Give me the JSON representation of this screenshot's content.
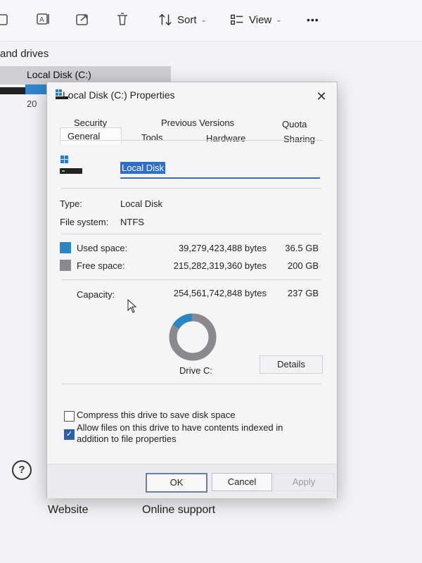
{
  "toolbar": {
    "sort_label": "Sort",
    "view_label": "View",
    "more_label": "•••"
  },
  "explorer": {
    "section_label": "and drives",
    "drive_item": "Local Disk (C:)",
    "drive_size_fragment": "20",
    "footer_links": [
      "Website",
      "Online support"
    ],
    "help_icon_text": "?"
  },
  "dialog": {
    "title": "Local Disk (C:) Properties",
    "close_icon": "✕",
    "tabs_row1": [
      "Security",
      "Previous Versions",
      "Quota"
    ],
    "tabs_row2": [
      "General",
      "Tools",
      "Hardware",
      "Sharing"
    ],
    "active_tab": "General",
    "drive_name": "Local Disk",
    "type_label": "Type:",
    "type_value": "Local Disk",
    "fs_label": "File system:",
    "fs_value": "NTFS",
    "used": {
      "label": "Used space:",
      "bytes": "39,279,423,488 bytes",
      "gb": "36.5 GB",
      "color": "#2b86c6"
    },
    "free": {
      "label": "Free space:",
      "bytes": "215,282,319,360 bytes",
      "gb": "200 GB",
      "color": "#8a8a8e"
    },
    "capacity": {
      "label": "Capacity:",
      "bytes": "254,561,742,848 bytes",
      "gb": "237 GB"
    },
    "used_fraction": 0.154,
    "drive_label": "Drive C:",
    "details_button": "Details",
    "compress_label": "Compress this drive to save disk space",
    "compress_checked": false,
    "index_label": "Allow files on this drive to have contents indexed in addition to file properties",
    "index_checked": true,
    "ok_button": "OK",
    "cancel_button": "Cancel",
    "apply_button": "Apply"
  }
}
